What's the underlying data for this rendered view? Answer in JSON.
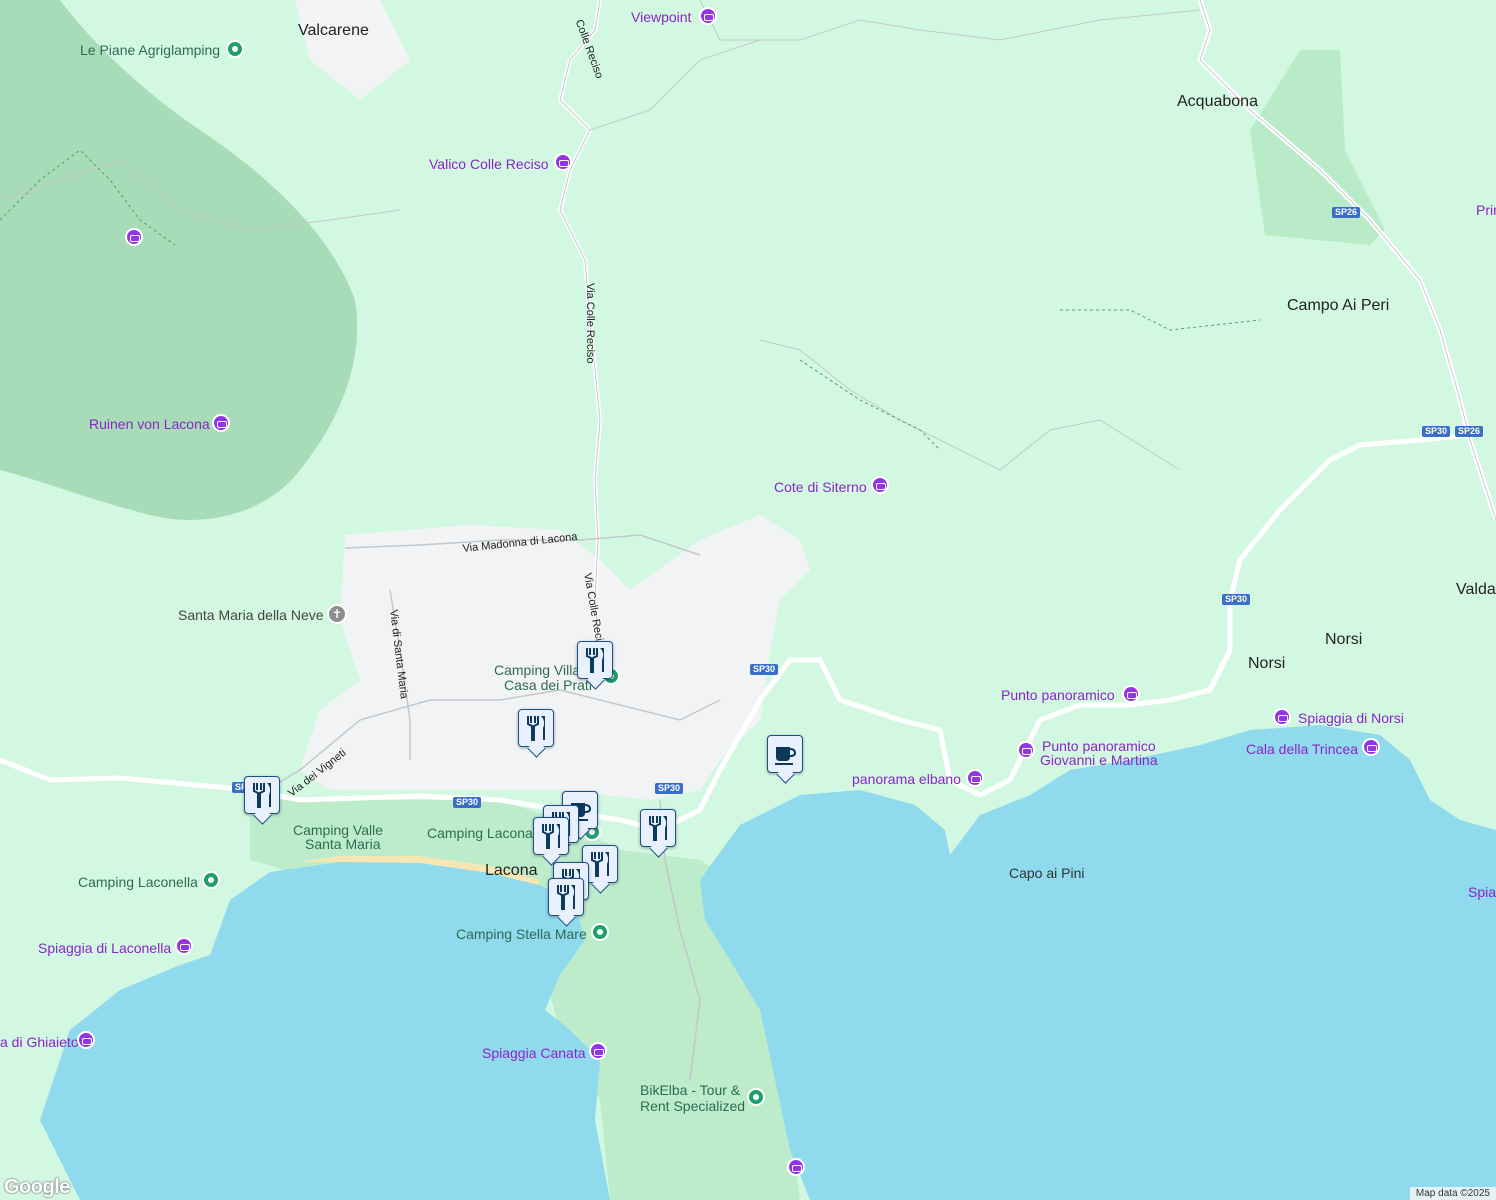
{
  "map": {
    "colors": {
      "land": "#d3f8e2",
      "forest": "#a8dcb8",
      "park": "#bdeccb",
      "urban": "#f1f3f4",
      "water": "#90daee",
      "beach": "#f6e6b4",
      "road": "#ffffff",
      "road_minor": "#c2c8cc",
      "poi_purple": "#9334e6",
      "camp_green": "#1f9e6e",
      "marker_border": "#1a4f8a"
    },
    "places": {
      "valcarene": "Valcarene",
      "acquabona": "Acquabona",
      "campo_ai_peri": "Campo Ai Peri",
      "norsi_a": "Norsi",
      "norsi_b": "Norsi",
      "lacona": "Lacona",
      "valda": "Valda",
      "prim": "Prim"
    },
    "pois": {
      "viewpoint": "Viewpoint",
      "valico": "Valico Colle Reciso",
      "ruinen": "Ruinen von Lacona",
      "cote": "Cote di Siterno",
      "punto": "Punto panoramico",
      "giovanni_1": "Punto panoramico",
      "giovanni_2": "Giovanni e Martina",
      "elbano": "panorama elbano",
      "spiaggia_norsi": "Spiaggia di Norsi",
      "trincea": "Cala della Trincea",
      "laconella_beach": "Spiaggia di Laconella",
      "ghiaieto": "a di Ghiaieto",
      "canata": "Spiaggia Canata",
      "spia": "Spia"
    },
    "camps": {
      "piane": "Le Piane Agriglamping",
      "villa_1": "Camping Villa",
      "villa_2": "Casa dei Prati",
      "valle_1": "Camping Valle",
      "valle_2": "Santa Maria",
      "lacona_camp": "Camping Lacona",
      "laconella": "Camping Laconella",
      "stella": "Camping Stella Mare"
    },
    "church": "Santa Maria della Neve",
    "bike": {
      "line1": "BikElba - Tour &",
      "line2": "Rent Specialized"
    },
    "coast": {
      "capo": "Capo ai Pini"
    },
    "streets": {
      "madonna": "Via Madonna di Lacona",
      "colle_top": "Colle Reciso",
      "colle_mid": "Via Colle Reciso",
      "colle_low": "Via Colle Recis",
      "santa_maria": "Via di Santa Maria",
      "vigneti": "Via dei Vigneti"
    },
    "shields": {
      "sp26_a": "SP26",
      "sp26_b": "SP26",
      "sp30_a": "SP30",
      "sp30_b": "SP30",
      "sp30_c": "SP30",
      "sp30_d": "SP30",
      "sp30_e": "SP30",
      "sp30_f": "SP30"
    },
    "markers": {
      "restaurant_icon": "restaurant-icon",
      "cafe_icon": "cafe-icon"
    },
    "attribution": "Map data ©2025",
    "logo": "Google"
  }
}
